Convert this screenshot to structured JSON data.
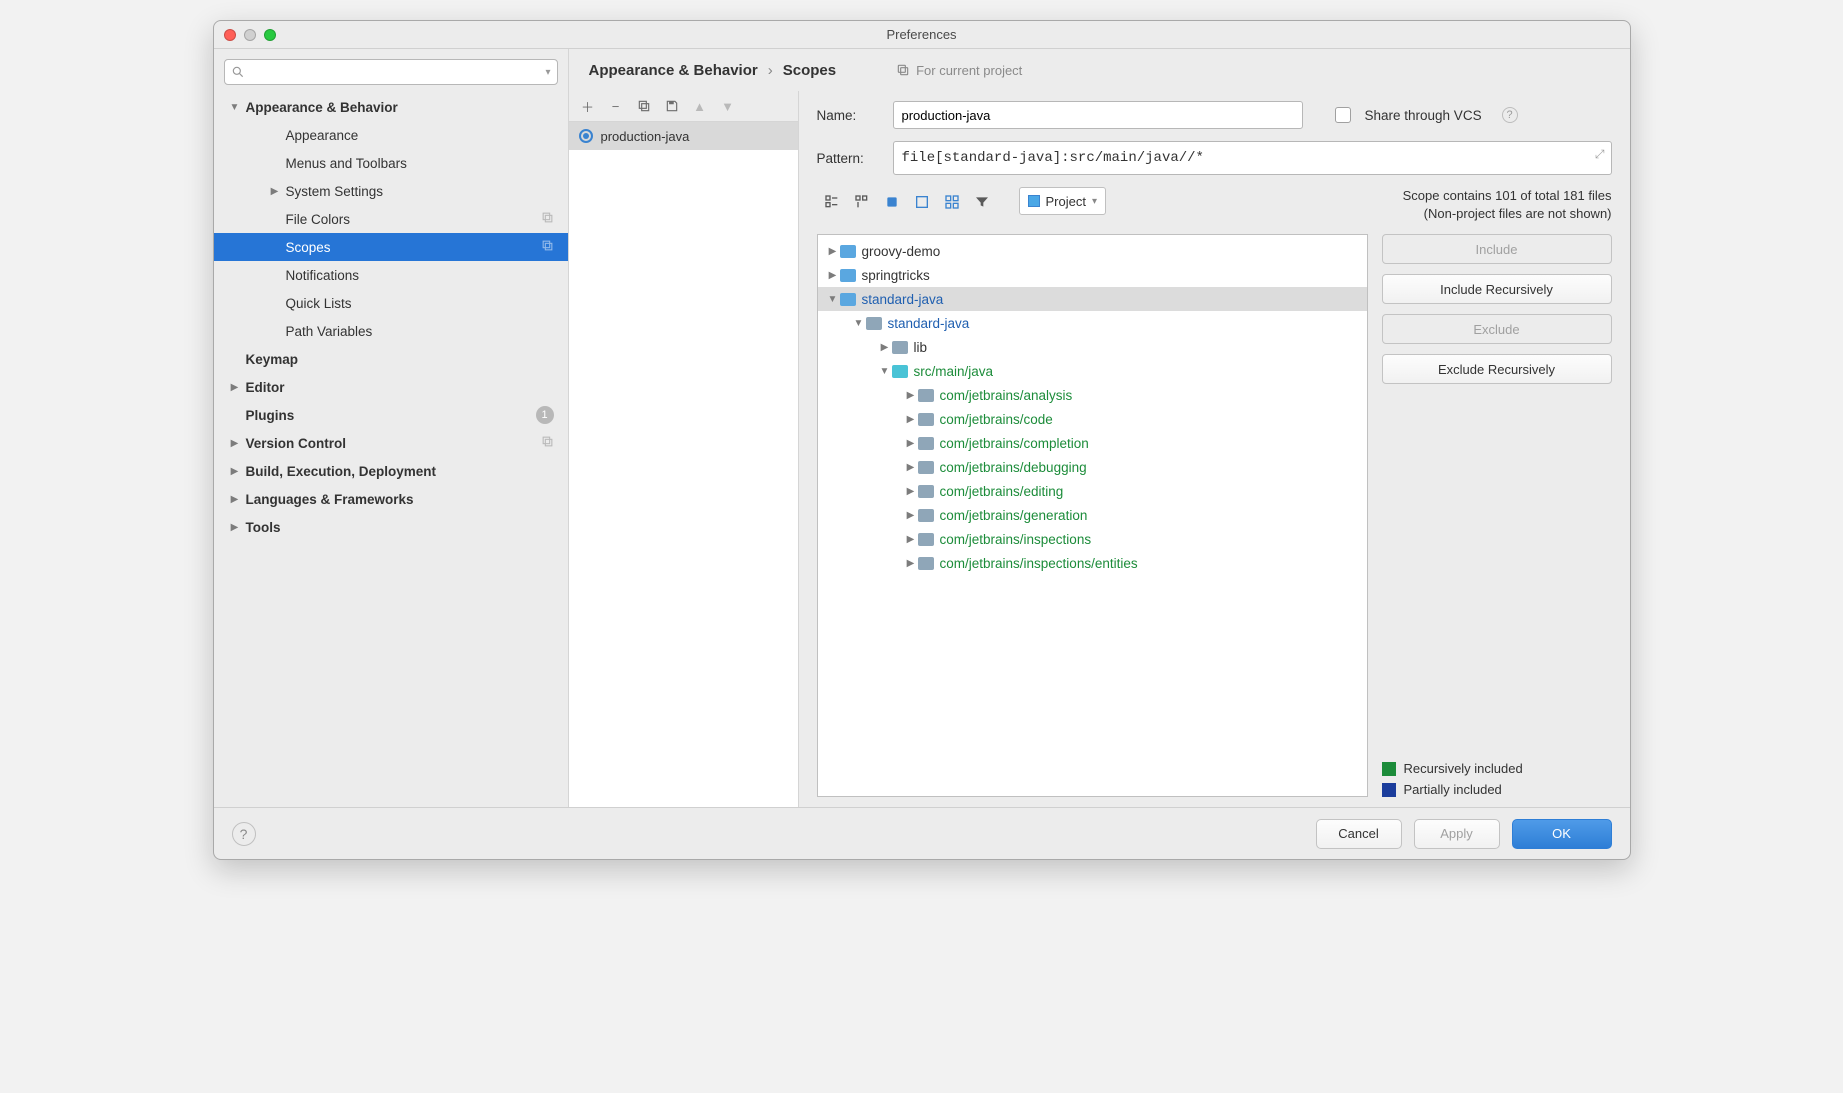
{
  "window": {
    "title": "Preferences"
  },
  "sidebar": {
    "search_placeholder": "",
    "items": [
      {
        "label": "Appearance & Behavior",
        "bold": true,
        "arrow": "down",
        "indent": 0
      },
      {
        "label": "Appearance",
        "indent": 1
      },
      {
        "label": "Menus and Toolbars",
        "indent": 1
      },
      {
        "label": "System Settings",
        "arrow": "right",
        "indent": 1
      },
      {
        "label": "File Colors",
        "indent": 1,
        "copyicon": true
      },
      {
        "label": "Scopes",
        "indent": 1,
        "selected": true,
        "copyicon": true
      },
      {
        "label": "Notifications",
        "indent": 1
      },
      {
        "label": "Quick Lists",
        "indent": 1
      },
      {
        "label": "Path Variables",
        "indent": 1
      },
      {
        "label": "Keymap",
        "bold": true,
        "indent": 0
      },
      {
        "label": "Editor",
        "bold": true,
        "arrow": "right",
        "indent": 0
      },
      {
        "label": "Plugins",
        "bold": true,
        "indent": 0,
        "badge": "1"
      },
      {
        "label": "Version Control",
        "bold": true,
        "arrow": "right",
        "indent": 0,
        "copyicon": true
      },
      {
        "label": "Build, Execution, Deployment",
        "bold": true,
        "arrow": "right",
        "indent": 0
      },
      {
        "label": "Languages & Frameworks",
        "bold": true,
        "arrow": "right",
        "indent": 0
      },
      {
        "label": "Tools",
        "bold": true,
        "arrow": "right",
        "indent": 0
      }
    ]
  },
  "breadcrumb": {
    "a": "Appearance & Behavior",
    "b": "Scopes",
    "note": "For current project"
  },
  "scopes": {
    "list": [
      "production-java"
    ]
  },
  "form": {
    "name_label": "Name:",
    "name_value": "production-java",
    "share_label": "Share through VCS",
    "pattern_label": "Pattern:",
    "pattern_value": "file[standard-java]:src/main/java//*",
    "dropdown": "Project",
    "scope_info_line1": "Scope contains 101 of total 181 files",
    "scope_info_line2": "(Non-project files are not shown)"
  },
  "tree": [
    {
      "name": "groovy-demo",
      "depth": 0,
      "arrow": "right",
      "style": ""
    },
    {
      "name": "springtricks",
      "depth": 0,
      "arrow": "right",
      "style": ""
    },
    {
      "name": "standard-java",
      "depth": 0,
      "arrow": "down",
      "style": "blue",
      "selected": true
    },
    {
      "name": "standard-java",
      "depth": 1,
      "arrow": "down",
      "style": "blue"
    },
    {
      "name": "lib",
      "depth": 2,
      "arrow": "right",
      "style": ""
    },
    {
      "name": "src/main/java",
      "depth": 2,
      "arrow": "down",
      "style": "green",
      "folderColor": "cyan"
    },
    {
      "name": "com/jetbrains/analysis",
      "depth": 3,
      "arrow": "right",
      "style": "green"
    },
    {
      "name": "com/jetbrains/code",
      "depth": 3,
      "arrow": "right",
      "style": "green"
    },
    {
      "name": "com/jetbrains/completion",
      "depth": 3,
      "arrow": "right",
      "style": "green"
    },
    {
      "name": "com/jetbrains/debugging",
      "depth": 3,
      "arrow": "right",
      "style": "green"
    },
    {
      "name": "com/jetbrains/editing",
      "depth": 3,
      "arrow": "right",
      "style": "green"
    },
    {
      "name": "com/jetbrains/generation",
      "depth": 3,
      "arrow": "right",
      "style": "green"
    },
    {
      "name": "com/jetbrains/inspections",
      "depth": 3,
      "arrow": "right",
      "style": "green"
    },
    {
      "name": "com/jetbrains/inspections/entities",
      "depth": 3,
      "arrow": "right",
      "style": "green"
    }
  ],
  "actions": {
    "include": "Include",
    "include_rec": "Include Recursively",
    "exclude": "Exclude",
    "exclude_rec": "Exclude Recursively",
    "legend_rec": "Recursively included",
    "legend_part": "Partially included"
  },
  "footer": {
    "cancel": "Cancel",
    "apply": "Apply",
    "ok": "OK"
  }
}
